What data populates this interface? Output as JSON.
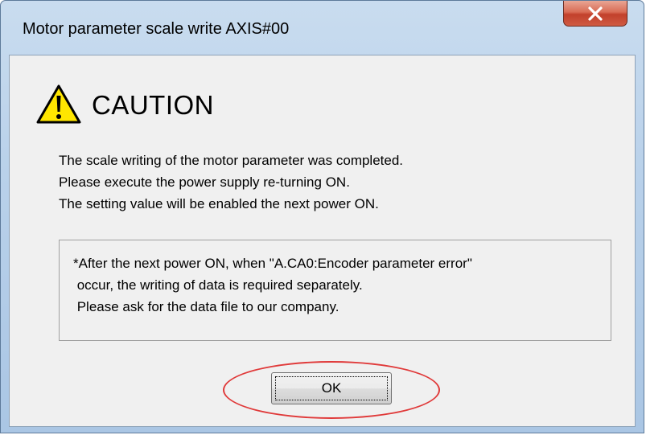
{
  "window": {
    "title": "Motor parameter scale write AXIS#00",
    "close_icon": "close-icon"
  },
  "dialog": {
    "icon": "warning-icon",
    "heading": "CAUTION",
    "messages": [
      "The scale writing of the motor parameter was completed.",
      "Please execute the power supply re-turning ON.",
      "The setting value will be enabled the next power ON."
    ],
    "note_lines": [
      "*After the next power ON, when \"A.CA0:Encoder parameter error\"",
      " occur, the writing of data is required separately.",
      " Please ask for the data file to our company."
    ]
  },
  "buttons": {
    "ok_label": "OK"
  },
  "colors": {
    "annotation": "#e03a3a",
    "warning_fill": "#ffe600"
  }
}
